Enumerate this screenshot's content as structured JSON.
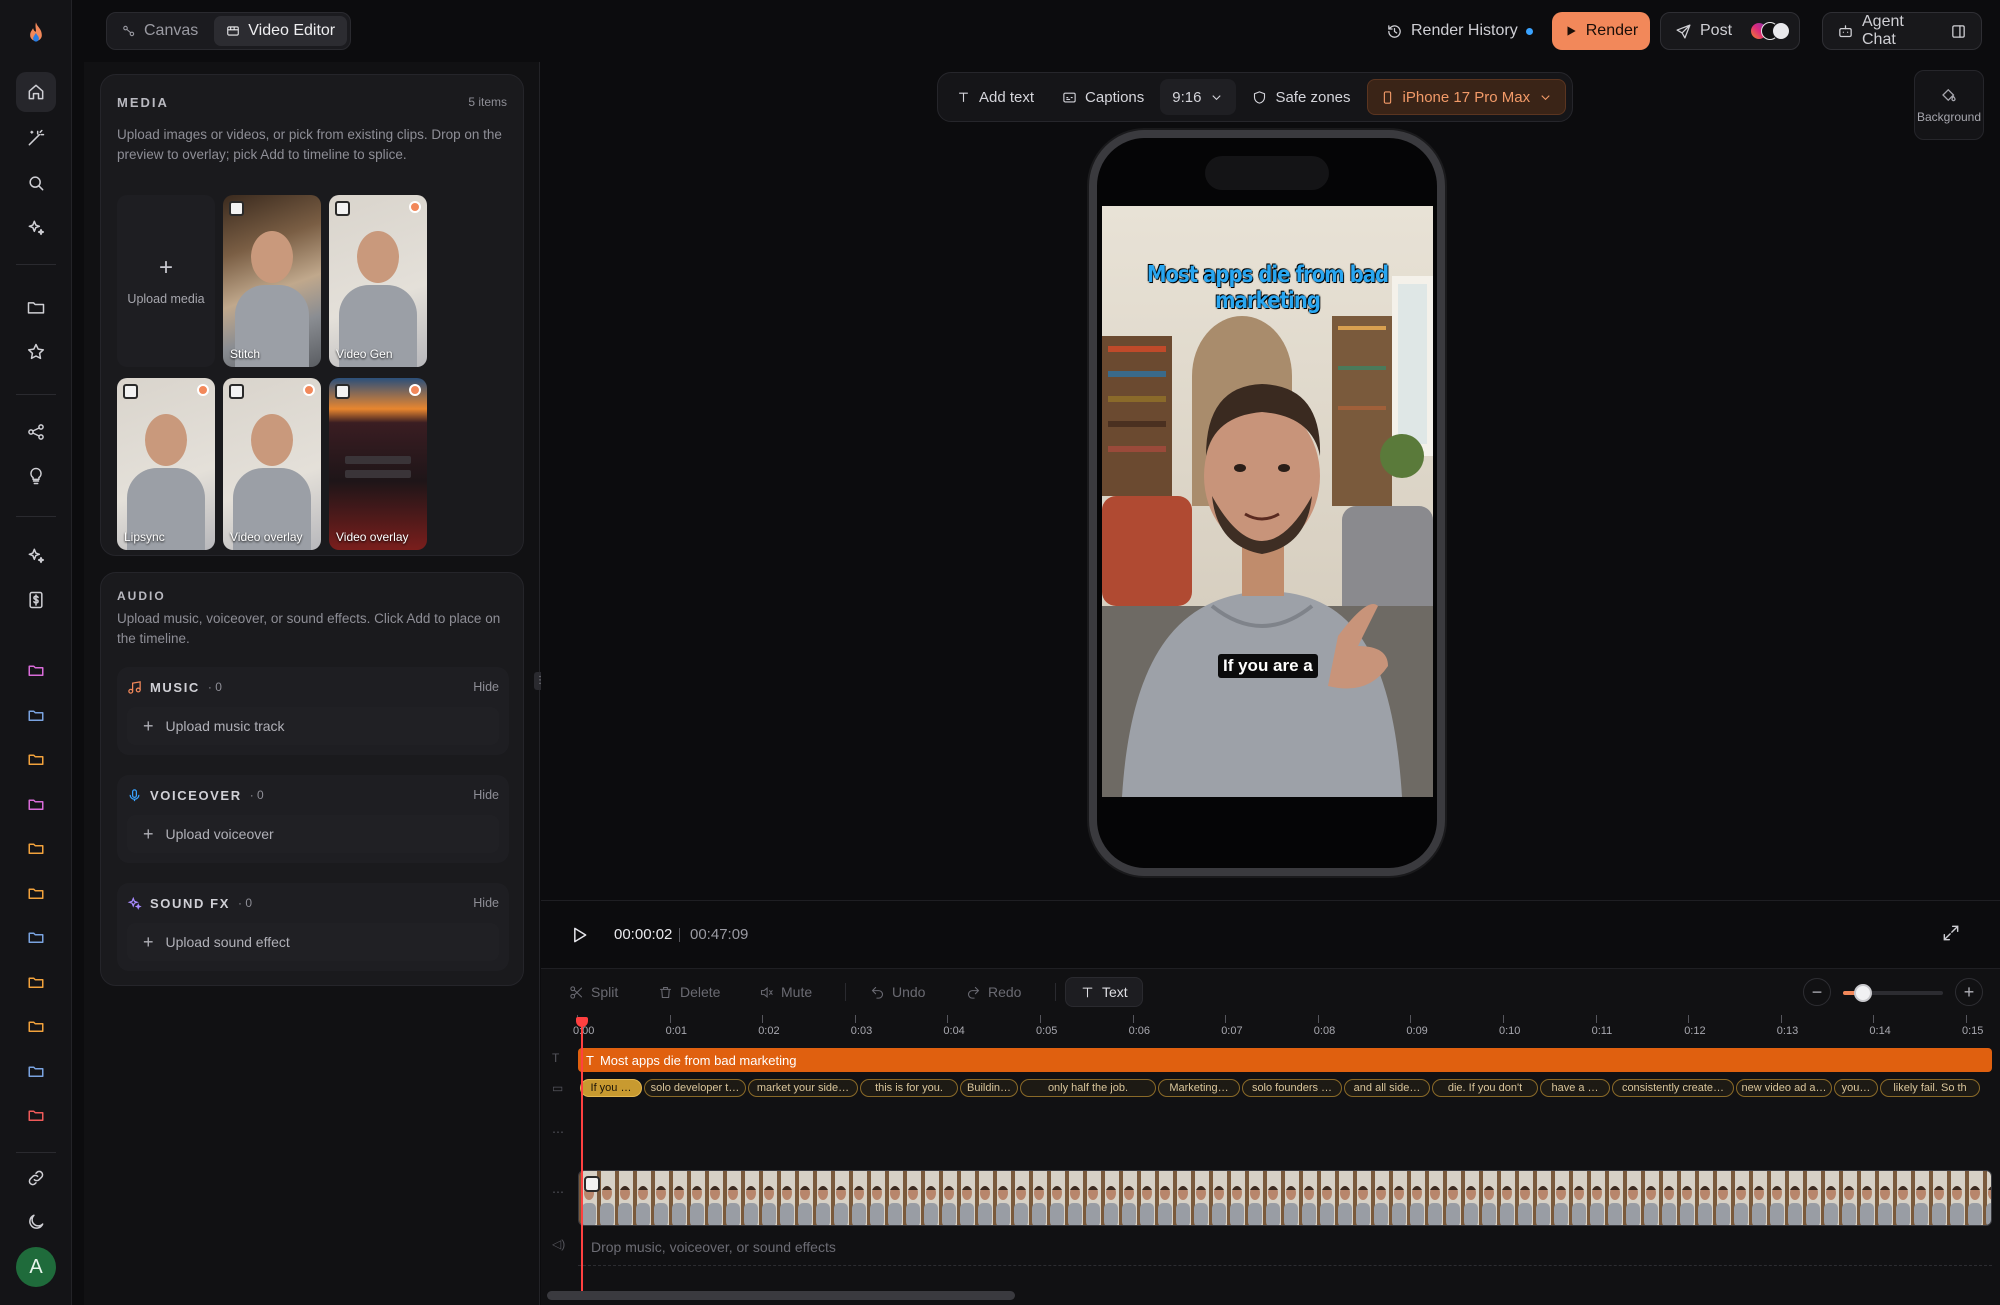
{
  "app": {
    "mode_tabs": [
      {
        "label": "Canvas",
        "icon": "canvas-icon",
        "active": false
      },
      {
        "label": "Video Editor",
        "icon": "film-icon",
        "active": true
      }
    ]
  },
  "topbar": {
    "render_history": "Render History",
    "render": "Render",
    "post": "Post",
    "agent_chat": "Agent Chat",
    "status_dot_color": "#3aa3ff",
    "accent": "#f2885a"
  },
  "rail": {
    "icons": [
      "home-icon",
      "magic-wand-icon",
      "search-icon",
      "sparkles-icon",
      "folder-icon",
      "star-icon",
      "share-icon",
      "lightbulb-icon",
      "sparkles-icon",
      "dollar-icon",
      "link-icon",
      "moon-icon"
    ],
    "folder_colors": [
      "#d96bd9",
      "#7aa3e0",
      "#f2a23c",
      "#d96bd9",
      "#f2a23c",
      "#f2a23c",
      "#7aa3e0",
      "#f2a23c",
      "#f2a23c",
      "#7aa3e0",
      "#ef5a5a"
    ],
    "avatar_initial": "A"
  },
  "media": {
    "title": "MEDIA",
    "count": "5 items",
    "description": "Upload images or videos, or pick from existing clips. Drop on the preview to overlay; pick Add to timeline to splice.",
    "upload_label": "Upload media",
    "items": [
      {
        "label": "Stitch"
      },
      {
        "label": "Video Gen"
      },
      {
        "label": "Lipsync"
      },
      {
        "label": "Video overlay"
      },
      {
        "label": "Video overlay"
      }
    ]
  },
  "audio": {
    "title": "AUDIO",
    "description": "Upload music, voiceover, or sound effects. Click Add to place on the timeline.",
    "sections": [
      {
        "title": "MUSIC",
        "count": "· 0",
        "hide": "Hide",
        "upload": "Upload music track",
        "icon": "music-note-icon",
        "icon_color": "#f2885a"
      },
      {
        "title": "VOICEOVER",
        "count": "· 0",
        "hide": "Hide",
        "upload": "Upload voiceover",
        "icon": "microphone-icon",
        "icon_color": "#3aa3ff"
      },
      {
        "title": "SOUND FX",
        "count": "· 0",
        "hide": "Hide",
        "upload": "Upload sound effect",
        "icon": "sparkles-icon",
        "icon_color": "#a98bff"
      }
    ]
  },
  "canvas_toolbar": {
    "add_text": "Add text",
    "captions": "Captions",
    "aspect": "9:16",
    "safe_zones": "Safe zones",
    "device": "iPhone 17 Pro Max",
    "background": "Background"
  },
  "preview": {
    "overlay_title": "Most apps die from bad marketing",
    "overlay_color": "#29a6f0",
    "caption": "If you are a"
  },
  "playback": {
    "current_time": "00:00:02",
    "total_time": "00:47:09"
  },
  "timeline_toolbar": {
    "split": "Split",
    "delete": "Delete",
    "mute": "Mute",
    "undo": "Undo",
    "redo": "Redo",
    "text": "Text",
    "zoom_level": 0.2
  },
  "timeline": {
    "ruler": [
      "0:00",
      "0:01",
      "0:02",
      "0:03",
      "0:04",
      "0:05",
      "0:06",
      "0:07",
      "0:08",
      "0:09",
      "0:10",
      "0:11",
      "0:12",
      "0:13",
      "0:14",
      "0:15"
    ],
    "text_clip": "Most apps die from bad marketing",
    "captions": [
      "If you …",
      "solo developer t…",
      "market your side…",
      "this is for you.",
      "Buildin…",
      "only half the job.",
      "Marketing…",
      "solo founders …",
      "and all side…",
      "die. If you don't",
      "have a …",
      "consistently create…",
      "new video ad a…",
      "you…",
      "likely fail. So th"
    ],
    "audio_drop": "Drop music, voiceover, or sound effects"
  }
}
